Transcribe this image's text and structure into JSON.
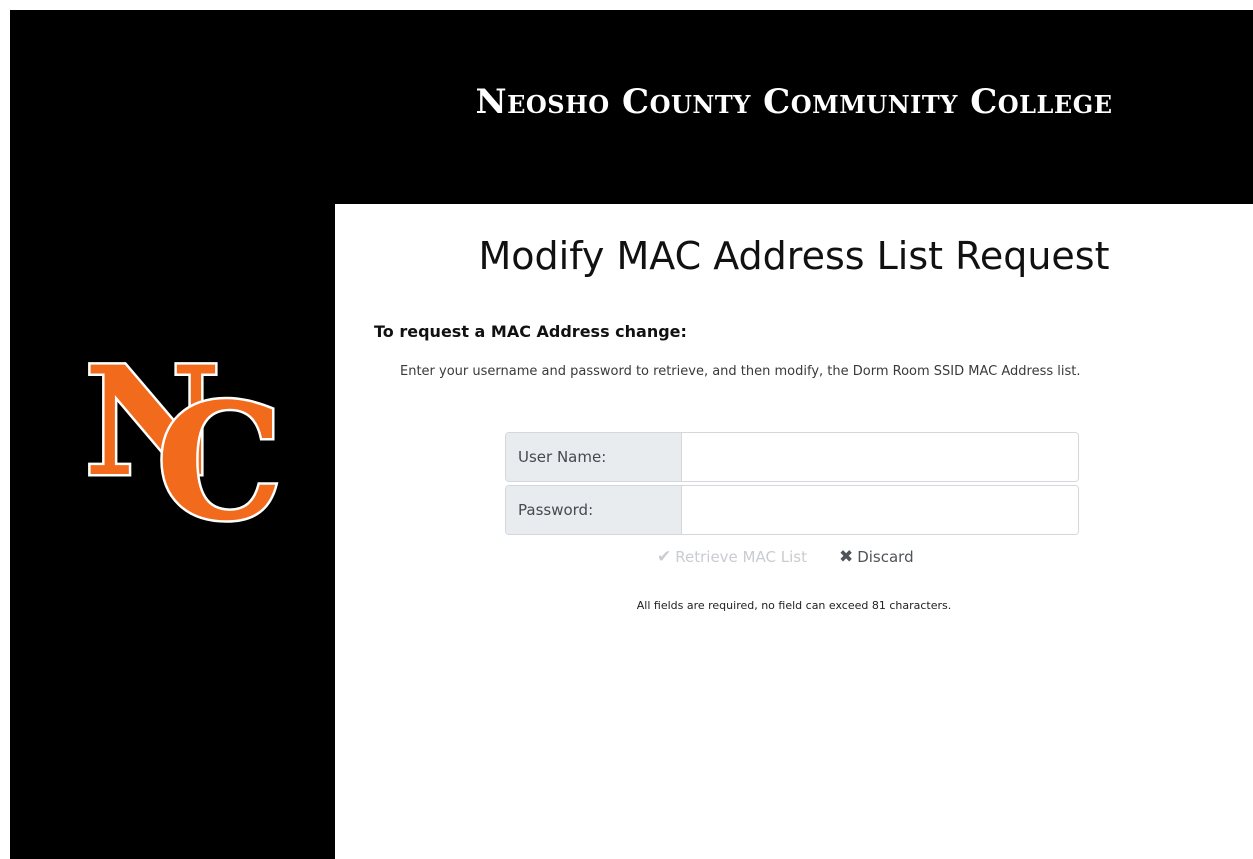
{
  "header": {
    "college_name": "Neosho County Community College"
  },
  "logo": {
    "letters": "NC",
    "colors": {
      "fill": "#f26a1b",
      "outline": "#ffffff"
    }
  },
  "main": {
    "title": "Modify MAC Address List Request",
    "section_heading": "To request a MAC Address change:",
    "instructions": "Enter your username and password to retrieve, and then modify, the Dorm Room SSID MAC Address list.",
    "form": {
      "username_label": "User Name:",
      "username_value": "",
      "password_label": "Password:",
      "password_value": ""
    },
    "actions": {
      "retrieve_icon": "checkmark-icon",
      "retrieve_label": "Retrieve MAC List",
      "retrieve_disabled": true,
      "discard_icon": "x-icon",
      "discard_label": "Discard"
    },
    "footnote": "All fields are required, no field can exceed 81 characters."
  },
  "colors": {
    "header_bg": "#000000",
    "label_bg": "#e9ecef",
    "disabled_text": "#c9ccd0",
    "brand_orange": "#f26a1b"
  }
}
